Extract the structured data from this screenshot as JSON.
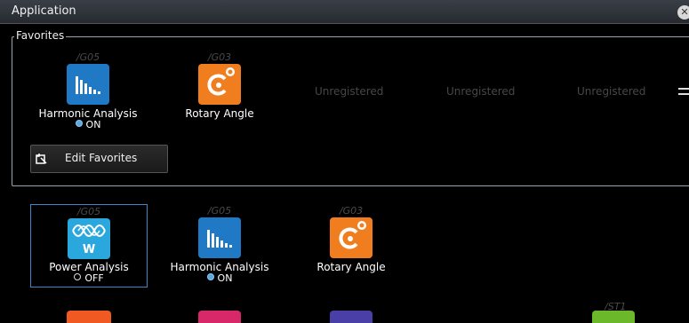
{
  "window": {
    "title": "Application"
  },
  "favorites": {
    "legend": "Favorites",
    "items": [
      {
        "code": "/G05",
        "label": "Harmonic Analysis",
        "status": "ON"
      },
      {
        "code": "/G03",
        "label": "Rotary Angle",
        "status": ""
      }
    ],
    "unregistered": [
      "Unregistered",
      "Unregistered",
      "Unregistered"
    ],
    "edit_label": "Edit Favorites"
  },
  "apps": [
    {
      "code": "/G05",
      "label": "Power Analysis",
      "status": "OFF",
      "icon_text": "W"
    },
    {
      "code": "/G05",
      "label": "Harmonic Analysis",
      "status": "ON"
    },
    {
      "code": "/G03",
      "label": "Rotary Angle",
      "status": ""
    }
  ],
  "partial_row": {
    "code": "/ST1"
  },
  "colors": {
    "harmonic": "#1f79c4",
    "rotary": "#f07d1e",
    "power": "#2aa7dc",
    "selection": "#3e86c7"
  }
}
